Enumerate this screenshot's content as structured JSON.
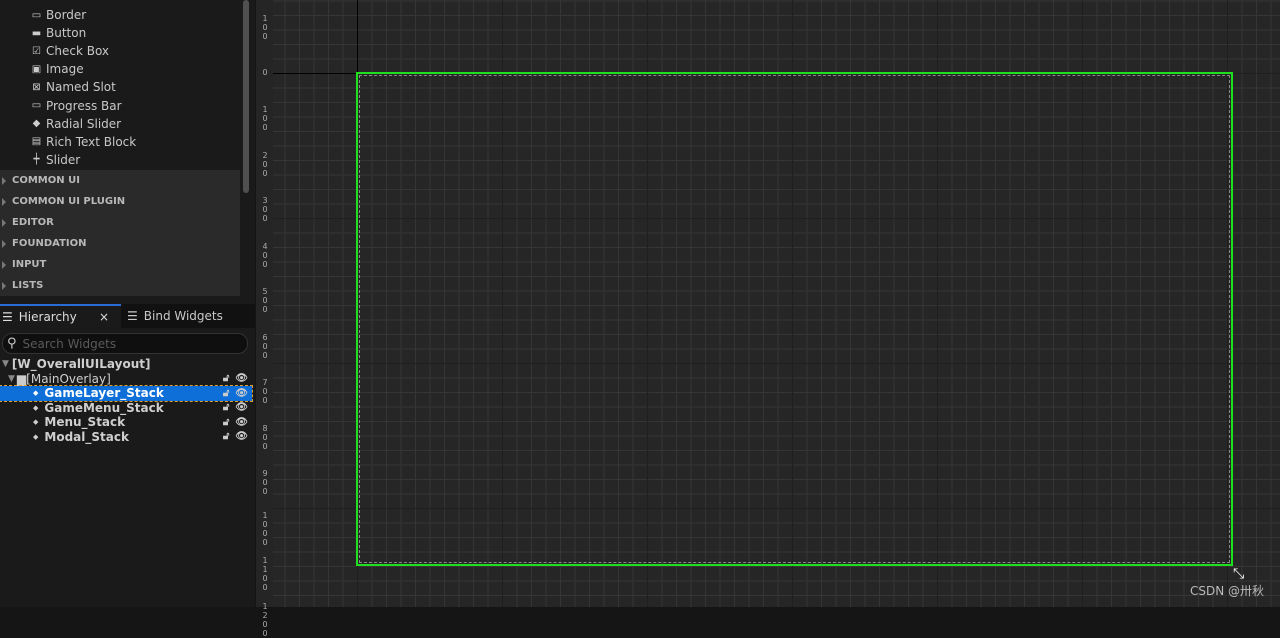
{
  "palette": {
    "items": [
      {
        "label": "Border",
        "icon": "border-icon",
        "glyph": "▭"
      },
      {
        "label": "Button",
        "icon": "button-icon",
        "glyph": "▬"
      },
      {
        "label": "Check Box",
        "icon": "checkbox-icon",
        "glyph": "☑"
      },
      {
        "label": "Image",
        "icon": "image-icon",
        "glyph": "▣"
      },
      {
        "label": "Named Slot",
        "icon": "named-slot-icon",
        "glyph": "⊠"
      },
      {
        "label": "Progress Bar",
        "icon": "progress-bar-icon",
        "glyph": "▭"
      },
      {
        "label": "Radial Slider",
        "icon": "radial-slider-icon",
        "glyph": "◆"
      },
      {
        "label": "Rich Text Block",
        "icon": "rich-text-icon",
        "glyph": "▤"
      },
      {
        "label": "Slider",
        "icon": "slider-icon",
        "glyph": "┿"
      }
    ],
    "categories": [
      "COMMON UI",
      "COMMON UI PLUGIN",
      "EDITOR",
      "FOUNDATION",
      "INPUT",
      "LISTS"
    ]
  },
  "tabs": {
    "hierarchy": "Hierarchy",
    "close": "×",
    "bind": "Bind Widgets"
  },
  "search": {
    "placeholder": "Search Widgets"
  },
  "tree": [
    {
      "label": "[W_OverallUILayout]",
      "indent": 0,
      "selected": false,
      "controls": false
    },
    {
      "label": "[MainOverlay]",
      "indent": 1,
      "selected": false,
      "controls": true
    },
    {
      "label": "GameLayer_Stack",
      "indent": 2,
      "selected": true,
      "controls": true
    },
    {
      "label": "GameMenu_Stack",
      "indent": 2,
      "selected": false,
      "controls": true
    },
    {
      "label": "Menu_Stack",
      "indent": 2,
      "selected": false,
      "controls": true
    },
    {
      "label": "Modal_Stack",
      "indent": 2,
      "selected": false,
      "controls": true
    }
  ],
  "ruler": [
    "100",
    "0",
    "100",
    "200",
    "300",
    "400",
    "500",
    "600",
    "700",
    "800",
    "900",
    "1000",
    "1100",
    "1200"
  ],
  "accent": "#0e6fd8",
  "frame_color": "#1ee01e",
  "watermark": "CSDN @卅秋"
}
